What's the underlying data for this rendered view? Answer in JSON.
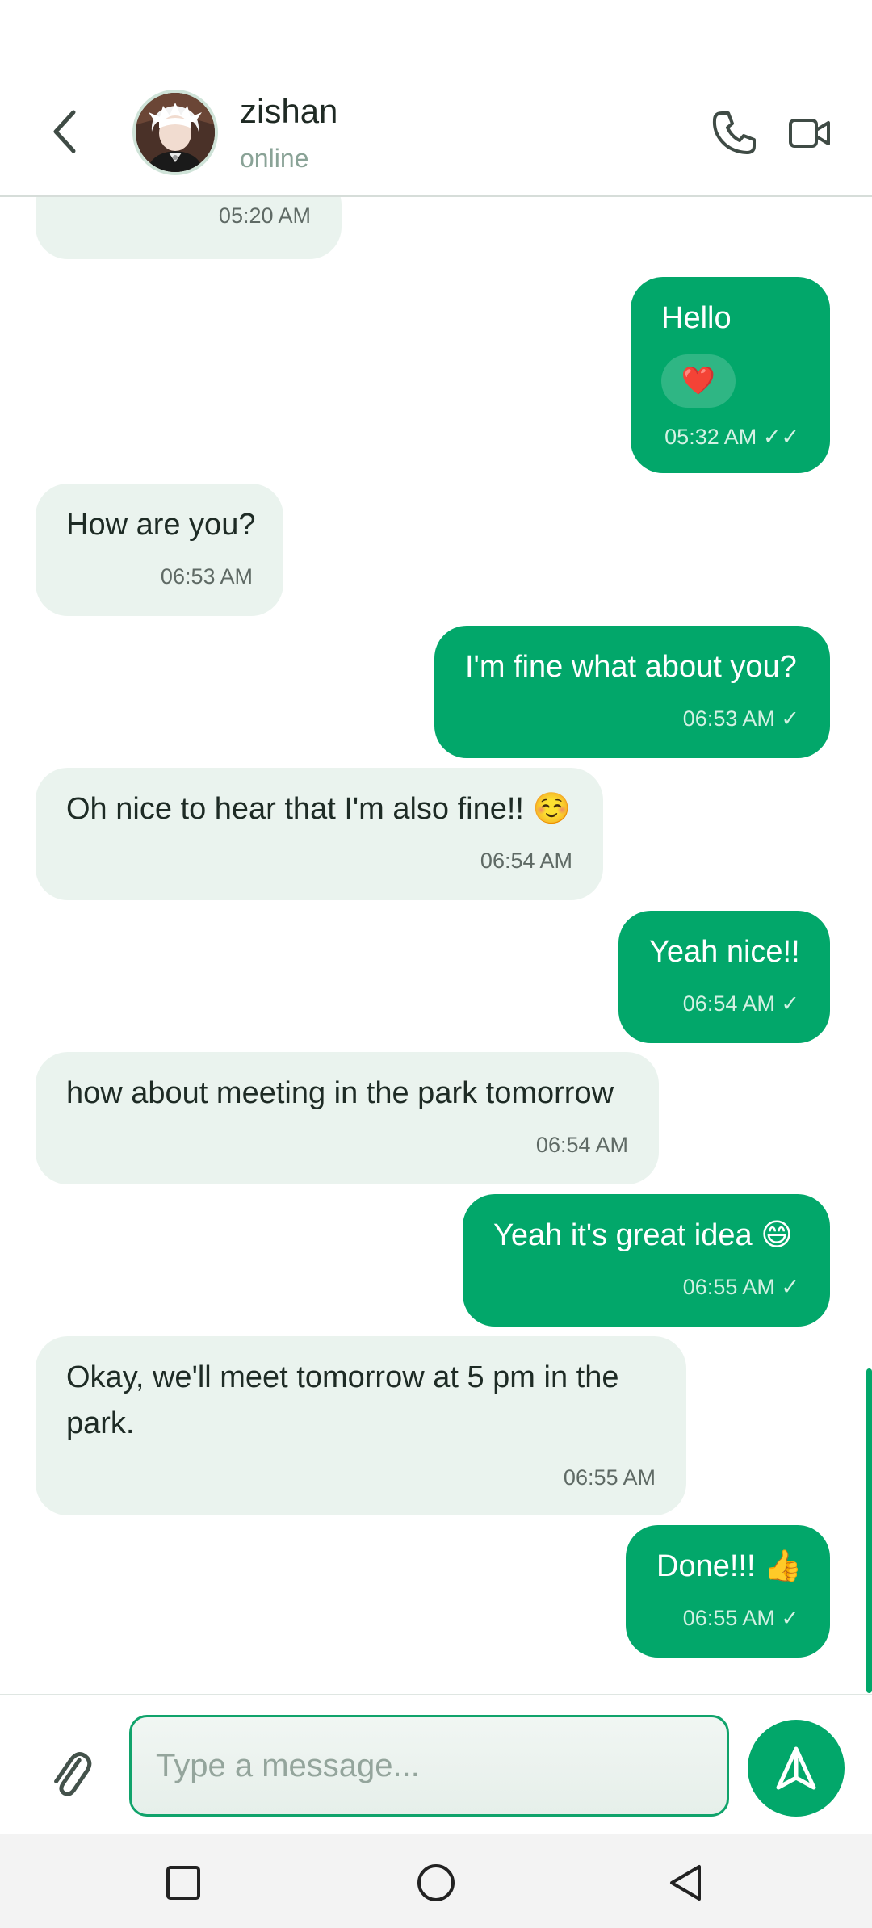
{
  "header": {
    "contact_name": "zishan",
    "status": "online",
    "icons": {
      "back": "chevron-left-icon",
      "call": "phone-icon",
      "video": "video-camera-icon"
    }
  },
  "messages": [
    {
      "direction": "incoming",
      "text": "",
      "time": "05:20 AM"
    },
    {
      "direction": "outgoing",
      "text": "Hello",
      "reaction": "❤️",
      "time": "05:32 AM",
      "ticks": "✓✓"
    },
    {
      "direction": "incoming",
      "text": "How are you?",
      "time": "06:53 AM"
    },
    {
      "direction": "outgoing",
      "text": "I'm fine what about you?",
      "time": "06:53 AM",
      "ticks": "✓"
    },
    {
      "direction": "incoming",
      "text": "Oh nice to hear that I'm also fine!! ☺️",
      "time": "06:54 AM"
    },
    {
      "direction": "outgoing",
      "text": "Yeah nice!!",
      "time": "06:54 AM",
      "ticks": "✓"
    },
    {
      "direction": "incoming",
      "text": "how about meeting in the park tomorrow",
      "time": "06:54 AM"
    },
    {
      "direction": "outgoing",
      "text": "Yeah it's great idea 😄",
      "time": "06:55 AM",
      "ticks": "✓"
    },
    {
      "direction": "incoming",
      "text_line1": "Okay, we'll meet tomorrow at 5 pm in the",
      "text_line2": "park.",
      "time": "06:55 AM"
    },
    {
      "direction": "outgoing",
      "text": "Done!!! 👍",
      "time": "06:55 AM",
      "ticks": "✓"
    }
  ],
  "composer": {
    "placeholder": "Type a message...",
    "value": "",
    "icons": {
      "attach": "paperclip-icon",
      "send": "send-icon"
    }
  },
  "system_nav": {
    "icons": [
      "recent-apps-icon",
      "home-icon",
      "back-icon"
    ]
  },
  "colors": {
    "accent": "#02a76a",
    "incoming_bubble": "#eaf3ee",
    "outgoing_bubble": "#02a76a"
  }
}
